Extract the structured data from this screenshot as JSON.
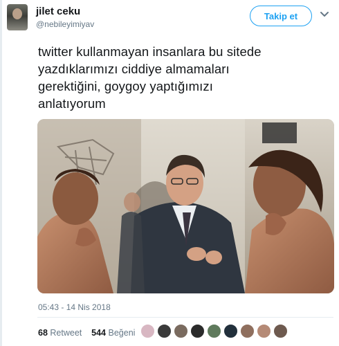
{
  "tweet": {
    "display_name": "jilet ceku",
    "handle": "@nebileyimiyav",
    "follow_label": "Takip et",
    "text_lines": [
      "twitter kullanmayan insanlara bu sitede",
      "yazdıklarımızı ciddiye almamaları",
      "gerektiğini, goygoy yaptığımızı",
      "anlatıyorum"
    ],
    "timestamp": "05:43 - 14 Nis 2018",
    "retweet_count": "68",
    "retweet_label": "Retweet",
    "like_count": "544",
    "like_label": "Beğeni"
  },
  "colors": {
    "accent": "#1da1f2",
    "secondary_text": "#657786",
    "divider": "#e6ecf0"
  },
  "icons": {
    "menu": "chevron-down-icon"
  }
}
